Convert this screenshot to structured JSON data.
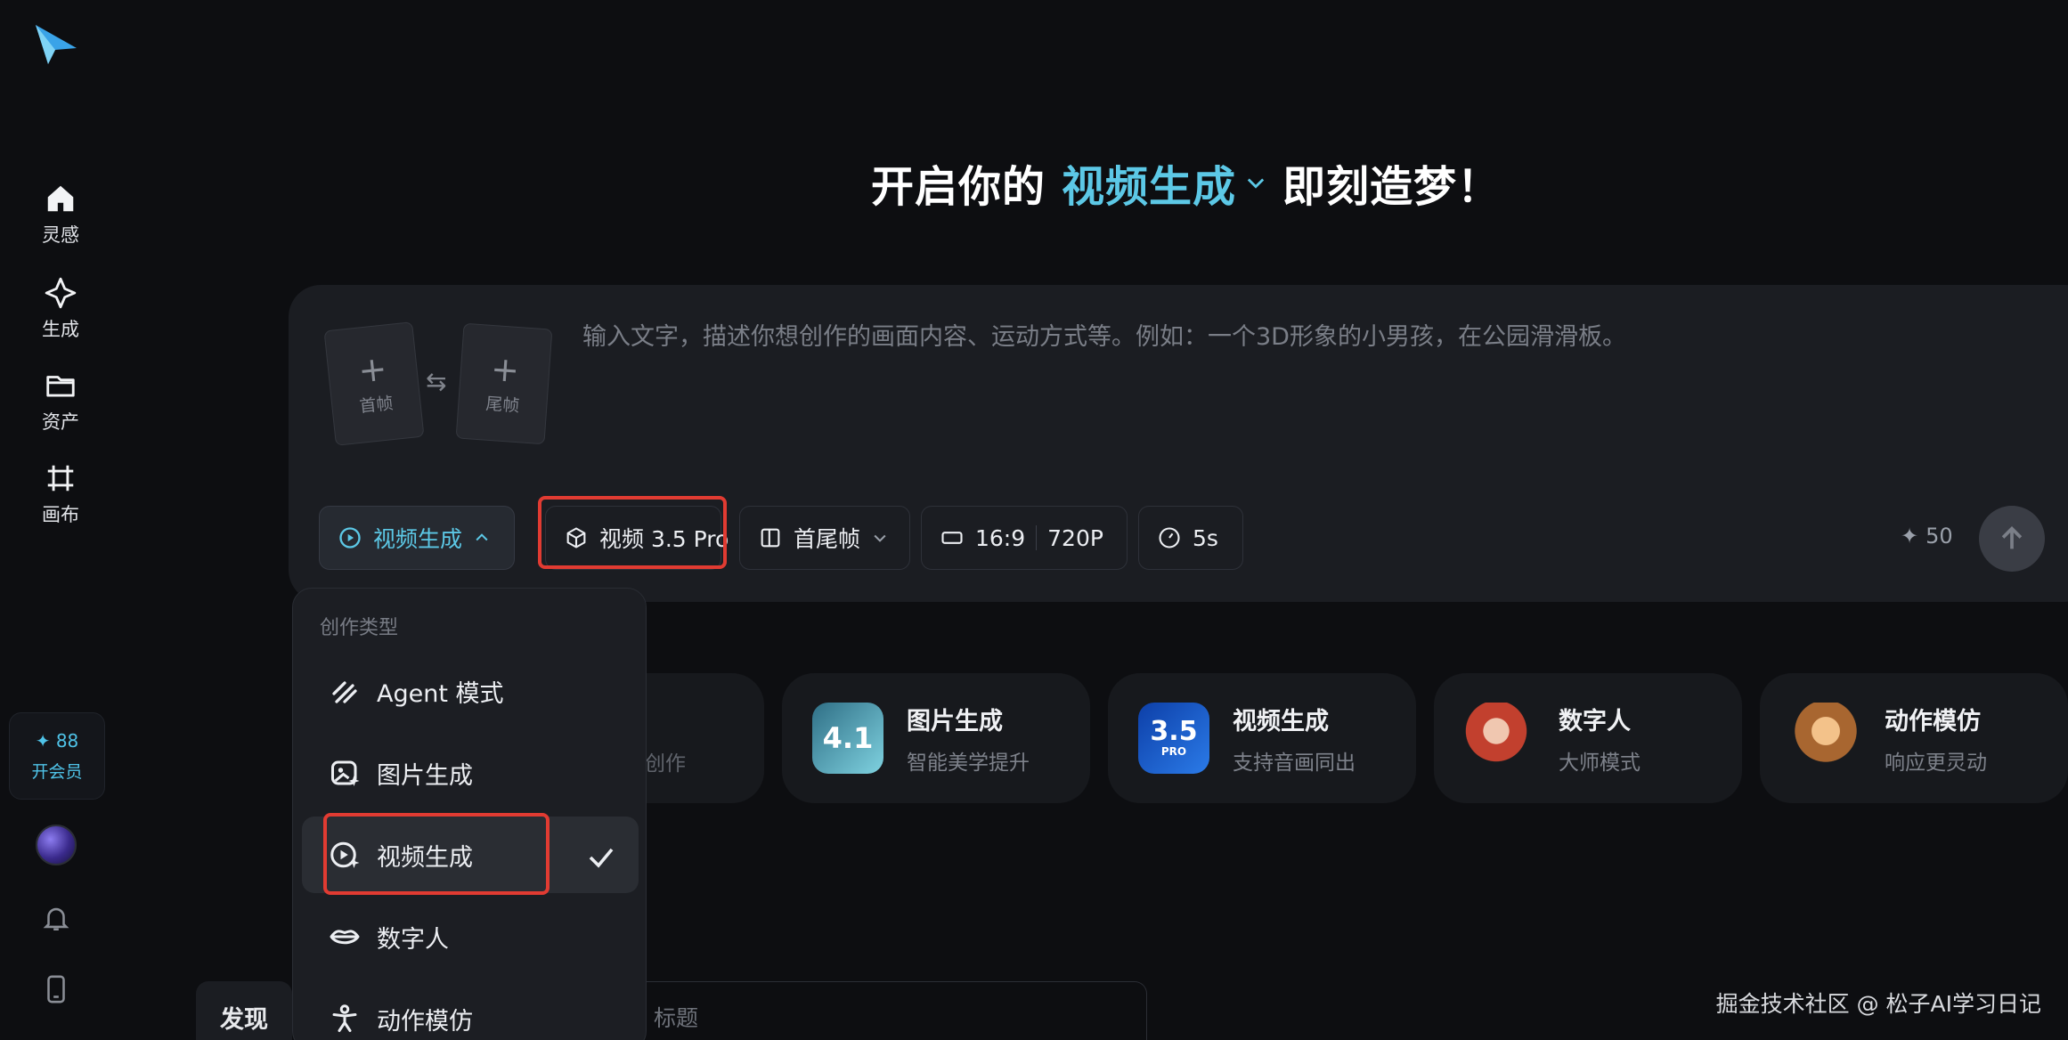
{
  "sidebar": {
    "items": [
      {
        "label": "灵感",
        "icon": "home-icon"
      },
      {
        "label": "生成",
        "icon": "sparkle-icon"
      },
      {
        "label": "资产",
        "icon": "folder-icon"
      },
      {
        "label": "画布",
        "icon": "canvas-icon"
      }
    ],
    "vip": {
      "points": "88",
      "join_label": "开会员"
    }
  },
  "headline": {
    "prefix": "开启你的",
    "mode": "视频生成",
    "suffix": "即刻造梦！"
  },
  "composer": {
    "first_frame": "首帧",
    "last_frame": "尾帧",
    "prompt_placeholder": "输入文字，描述你想创作的画面内容、运动方式等。例如：一个3D形象的小男孩，在公园滑滑板。",
    "mode_chip": "视频生成",
    "model_chip": "视频 3.5 Pro",
    "frame_chip": "首尾帧",
    "ratio": "16:9",
    "resolution": "720P",
    "duration": "5s",
    "cost": "50"
  },
  "dropdown": {
    "title": "创作类型",
    "items": [
      {
        "label": "Agent 模式",
        "icon": "agent-icon"
      },
      {
        "label": "图片生成",
        "icon": "image-gen-icon"
      },
      {
        "label": "视频生成",
        "icon": "video-gen-icon",
        "selected": true
      },
      {
        "label": "数字人",
        "icon": "lips-icon"
      },
      {
        "label": "动作模仿",
        "icon": "motion-icon"
      }
    ]
  },
  "cards": [
    {
      "title": "图片生成",
      "subtitle": "智能美学提升",
      "badge": "4.1"
    },
    {
      "title": "视频生成",
      "subtitle": "支持音画同出",
      "badge": "3.5",
      "badge_sub": "PRO"
    },
    {
      "title": "数字人",
      "subtitle": "大师模式"
    },
    {
      "title": "动作模仿",
      "subtitle": "响应更灵动"
    }
  ],
  "hidden_card_text": "创作",
  "bottom": {
    "discover": "发现",
    "title_placeholder": "标题"
  },
  "watermark": "掘金技术社区 @ 松子AI学习日记",
  "colors": {
    "accent": "#5cc8e6",
    "highlight": "#e13b32",
    "background": "#0d0e11"
  }
}
